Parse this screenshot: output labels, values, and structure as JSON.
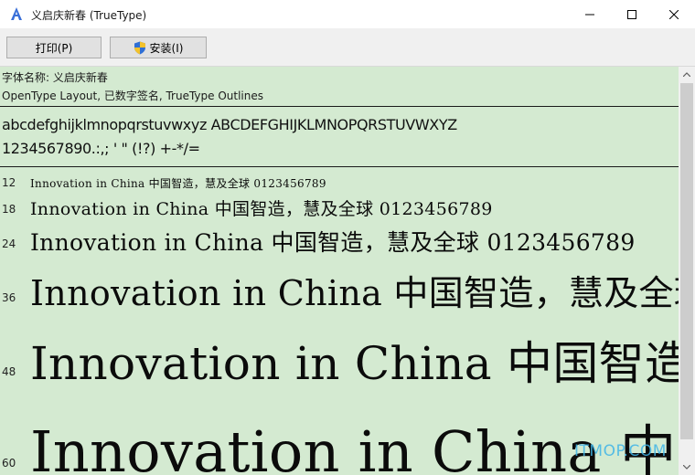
{
  "window": {
    "title": "义启庆新春 (TrueType)",
    "icon": "font-a-icon"
  },
  "toolbar": {
    "print_label": "打印(P)",
    "install_label": "安装(I)",
    "install_icon": "uac-shield-icon"
  },
  "font_info": {
    "name_line": "字体名称: 义启庆新春",
    "details_line": "OpenType Layout, 已数字签名, TrueType Outlines"
  },
  "charset": {
    "letters": "abcdefghijklmnopqrstuvwxyz ABCDEFGHIJKLMNOPQRSTUVWXYZ",
    "digits_symbols": "1234567890.:,; ' \" (!?) +-*/="
  },
  "samples": [
    {
      "size": "12",
      "text": "Innovation in China 中国智造，慧及全球 0123456789"
    },
    {
      "size": "18",
      "text": "Innovation in China 中国智造，慧及全球 0123456789"
    },
    {
      "size": "24",
      "text": "Innovation in China 中国智造，慧及全球 0123456789"
    },
    {
      "size": "36",
      "text": "Innovation in China 中国智造，慧及全球"
    },
    {
      "size": "48",
      "text": "Innovation in China 中国智造"
    },
    {
      "size": "60",
      "text": "Innovation in China 中"
    }
  ],
  "watermark": "ITMOP.COM",
  "colors": {
    "preview_bg": "#d4ead1",
    "toolbar_bg": "#f0f0f0",
    "button_bg": "#e1e1e1",
    "watermark": "#3fb5e8"
  }
}
